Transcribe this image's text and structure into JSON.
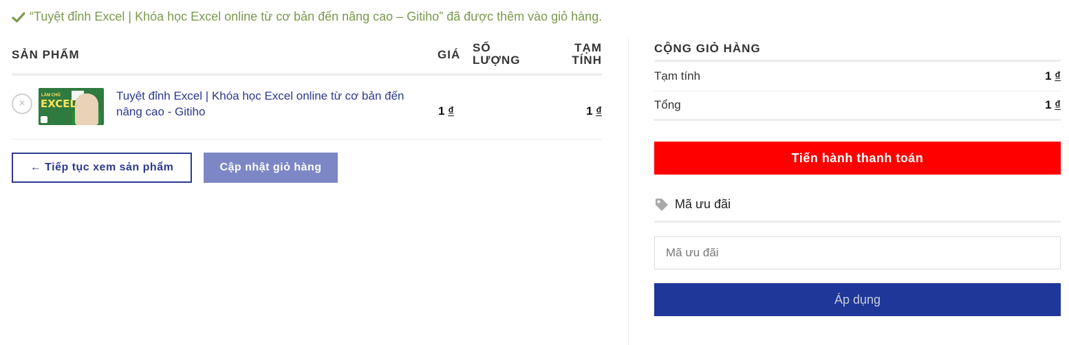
{
  "notice": {
    "text": "“Tuyệt đỉnh Excel | Khóa học Excel online từ cơ bản đến nâng cao – Gitiho” đã được thêm vào giỏ hàng.",
    "color": "#7a9a4c",
    "icon": "check-icon"
  },
  "cart": {
    "headers": {
      "product": "SẢN PHẨM",
      "price": "GIÁ",
      "quantity": "SỐ LƯỢNG",
      "subtotal": "TẠM TÍNH"
    },
    "items": [
      {
        "remove_symbol": "×",
        "thumbnail": {
          "top_text": "LÀM CHỦ",
          "main_text": "EXCEL"
        },
        "name": "Tuyệt đỉnh Excel | Khóa học Excel online từ cơ bản đến nâng cao - Gitiho",
        "price_amount": "1",
        "price_currency": "₫",
        "subtotal_amount": "1",
        "subtotal_currency": "₫"
      }
    ],
    "continue_label": "← Tiếp tục xem sản phẩm",
    "update_label": "Cập nhật giỏ hàng"
  },
  "totals": {
    "title": "CỘNG GIỎ HÀNG",
    "subtotal_label": "Tạm tính",
    "subtotal_amount": "1",
    "subtotal_currency": "₫",
    "total_label": "Tổng",
    "total_amount": "1",
    "total_currency": "₫",
    "checkout_label": "Tiến hành thanh toán",
    "checkout_color": "#ff0000"
  },
  "coupon": {
    "heading": "Mã ưu đãi",
    "placeholder": "Mã ưu đãi",
    "value": "",
    "apply_label": "Áp dụng",
    "apply_color": "#1f3799"
  },
  "colors": {
    "link": "#2b3990",
    "update_button": "#7d87c6"
  }
}
